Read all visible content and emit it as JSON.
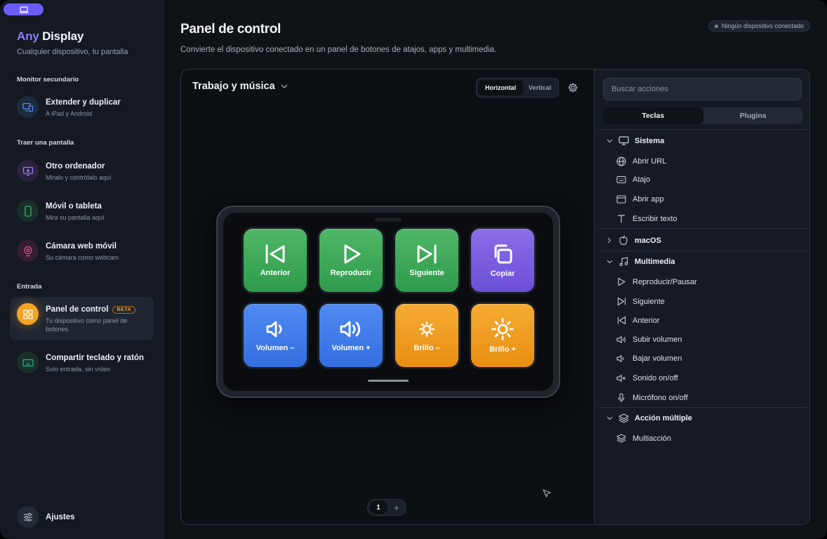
{
  "app": {
    "brand_part1": "Any",
    "brand_part2": "Display",
    "tagline": "Cualquier dispositivo, tu pantalla"
  },
  "sidebar": {
    "sections": {
      "secondary": "Monitor secundario",
      "bring": "Traer una pantalla",
      "input": "Entrada"
    },
    "items": [
      {
        "label": "Extender y duplicar",
        "sub": "A iPad y Android",
        "icon": "monitor-tablet-icon",
        "color": "#4f8bf2"
      },
      {
        "label": "Otro ordenador",
        "sub": "Míralo y contrólalo aquí",
        "icon": "monitor-in-icon",
        "color": "#9b7cf0"
      },
      {
        "label": "Móvil o tableta",
        "sub": "Mira su pantalla aquí",
        "icon": "phone-icon",
        "color": "#3fb46a"
      },
      {
        "label": "Cámara web móvil",
        "sub": "Su cámara como webcam",
        "icon": "webcam-icon",
        "color": "#e0509a"
      },
      {
        "label": "Panel de control",
        "badge": "BETA",
        "sub": "Tu dispositivo como panel de botones",
        "icon": "grid-icon",
        "color": "#f5a524"
      },
      {
        "label": "Compartir teclado y ratón",
        "sub": "Solo entrada, sin vídeo",
        "icon": "keyboard-icon",
        "color": "#2fb08a"
      }
    ],
    "settings": "Ajustes"
  },
  "header": {
    "title": "Panel de control",
    "subtitle": "Convierte el dispositivo conectado en un panel de botones de atajos, apps y multimedia.",
    "status": "Ningún dispositivo conectado"
  },
  "canvas": {
    "profile": "Trabajo y música",
    "orientation_horizontal": "Horizontal",
    "orientation_vertical": "Vertical",
    "page": "1",
    "add": "+",
    "keys": [
      {
        "label": "Anterior",
        "icon": "skip-back-icon",
        "color": "green"
      },
      {
        "label": "Reproducir",
        "icon": "play-icon",
        "color": "green"
      },
      {
        "label": "Siguiente",
        "icon": "skip-forward-icon",
        "color": "green"
      },
      {
        "label": "Copiar",
        "icon": "copy-icon",
        "color": "purple"
      },
      {
        "label": "Volumen –",
        "icon": "volume-low-icon",
        "color": "blue"
      },
      {
        "label": "Volumen +",
        "icon": "volume-high-icon",
        "color": "blue"
      },
      {
        "label": "Brillo –",
        "icon": "brightness-low-icon",
        "color": "orange"
      },
      {
        "label": "Brillo +",
        "icon": "brightness-high-icon",
        "color": "orange"
      }
    ]
  },
  "actions": {
    "search_placeholder": "Buscar acciones",
    "tab_keys": "Teclas",
    "tab_plugins": "Plugins",
    "groups": {
      "system": "Sistema",
      "macos": "macOS",
      "multimedia": "Multimedia",
      "multi": "Acción múltiple"
    },
    "system_items": [
      "Abrir URL",
      "Atajo",
      "Abrir app",
      "Escribir texto"
    ],
    "multimedia_items": [
      "Reproducir/Pausar",
      "Siguiente",
      "Anterior",
      "Subir volumen",
      "Bajar volumen",
      "Sonido on/off",
      "Micrófono on/off"
    ],
    "multi_items": [
      "Multiacción"
    ]
  }
}
